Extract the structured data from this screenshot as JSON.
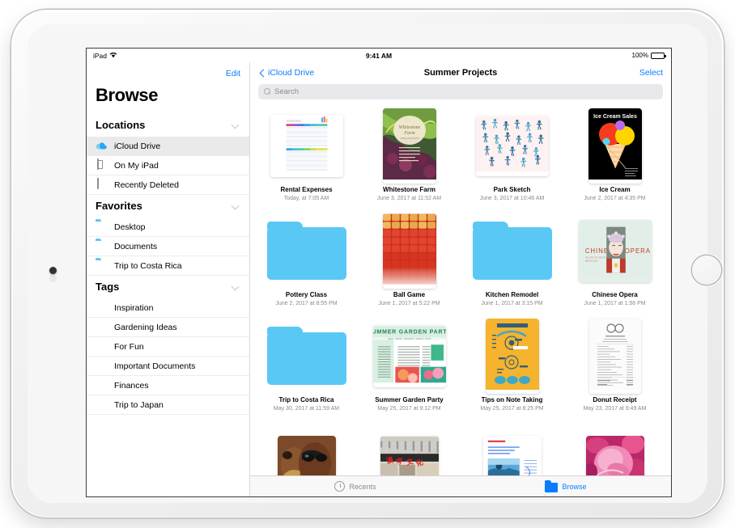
{
  "status_bar": {
    "carrier": "iPad",
    "wifi_icon": "wifi-icon",
    "time": "9:41 AM",
    "battery_percent": "100%"
  },
  "sidebar": {
    "edit_label": "Edit",
    "title": "Browse",
    "sections": [
      {
        "header": "Locations",
        "items": [
          {
            "label": "iCloud Drive",
            "icon": "cloud-icon",
            "selected": true
          },
          {
            "label": "On My iPad",
            "icon": "device-icon",
            "selected": false
          },
          {
            "label": "Recently Deleted",
            "icon": "trash-icon",
            "selected": false
          }
        ]
      },
      {
        "header": "Favorites",
        "items": [
          {
            "label": "Desktop",
            "icon": "folder-icon",
            "selected": false
          },
          {
            "label": "Documents",
            "icon": "folder-icon",
            "selected": false
          },
          {
            "label": "Trip to Costa Rica",
            "icon": "folder-icon",
            "selected": false
          }
        ]
      },
      {
        "header": "Tags",
        "items": [
          {
            "label": "Inspiration",
            "icon": "tag-dot-icon",
            "color": "#1eb3ef",
            "selected": false
          },
          {
            "label": "Gardening Ideas",
            "icon": "tag-dot-icon",
            "color": "#1ec42e",
            "selected": false
          },
          {
            "label": "For Fun",
            "icon": "tag-dot-icon",
            "color": "#ffc400",
            "selected": false
          },
          {
            "label": "Important Documents",
            "icon": "tag-dot-icon",
            "color": "#f02c2c",
            "selected": false
          },
          {
            "label": "Finances",
            "icon": "tag-dot-icon",
            "color": "#5a5a5f",
            "selected": false
          },
          {
            "label": "Trip to Japan",
            "icon": "tag-dot-icon",
            "color": "#c857e8",
            "selected": false
          }
        ]
      }
    ]
  },
  "nav": {
    "back_label": "iCloud Drive",
    "title": "Summer Projects",
    "select_label": "Select"
  },
  "search": {
    "placeholder": "Search",
    "value": ""
  },
  "files": [
    {
      "name": "Rental Expenses",
      "date": "Today, at 7:05 AM",
      "kind": "spreadsheet"
    },
    {
      "name": "Whitestone Farm",
      "date": "June 3, 2017 at 11:52 AM",
      "kind": "poster-farm"
    },
    {
      "name": "Park Sketch",
      "date": "June 3, 2017 at 10:46 AM",
      "kind": "sketch"
    },
    {
      "name": "Ice Cream",
      "date": "June 2, 2017 at 4:35 PM",
      "kind": "poster-icecream",
      "poster_title": "Ice Cream Sales"
    },
    {
      "name": "Pottery Class",
      "date": "June 2, 2017 at 8:55 PM",
      "kind": "folder"
    },
    {
      "name": "Ball Game",
      "date": "June 1, 2017 at 5:22 PM",
      "kind": "photo-seats"
    },
    {
      "name": "Kitchen Remodel",
      "date": "June 1, 2017 at 3:15 PM",
      "kind": "folder"
    },
    {
      "name": "Chinese Opera",
      "date": "June 1, 2017 at 1:56 PM",
      "kind": "poster-opera",
      "poster_title_left": "CHINESE",
      "poster_title_right": "OPERA"
    },
    {
      "name": "Trip to Costa Rica",
      "date": "May 30, 2017 at 11:59 AM",
      "kind": "folder"
    },
    {
      "name": "Summer Garden Party",
      "date": "May 25, 2017 at 9:12 PM",
      "kind": "doc-garden",
      "doc_title": "SUMMER GARDEN PARTY"
    },
    {
      "name": "Tips on Note Taking",
      "date": "May 25, 2017 at 8:25 PM",
      "kind": "poster-notes"
    },
    {
      "name": "Donut Receipt",
      "date": "May 23, 2017 at 9:49 AM",
      "kind": "receipt"
    },
    {
      "name": "",
      "date": "",
      "kind": "photo-sunglasses"
    },
    {
      "name": "",
      "date": "",
      "kind": "photo-market"
    },
    {
      "name": "",
      "date": "",
      "kind": "doc-letter"
    },
    {
      "name": "",
      "date": "",
      "kind": "photo-flower"
    }
  ],
  "tab_bar": {
    "tabs": [
      {
        "label": "Recents",
        "icon": "clock-icon",
        "active": false
      },
      {
        "label": "Browse",
        "icon": "folder-icon",
        "active": true
      }
    ]
  },
  "colors": {
    "accent_blue": "#0a7bff",
    "folder_blue": "#5ac8f5",
    "secondary_text": "#8a8a8f",
    "selected_row": "#eaeaea"
  }
}
